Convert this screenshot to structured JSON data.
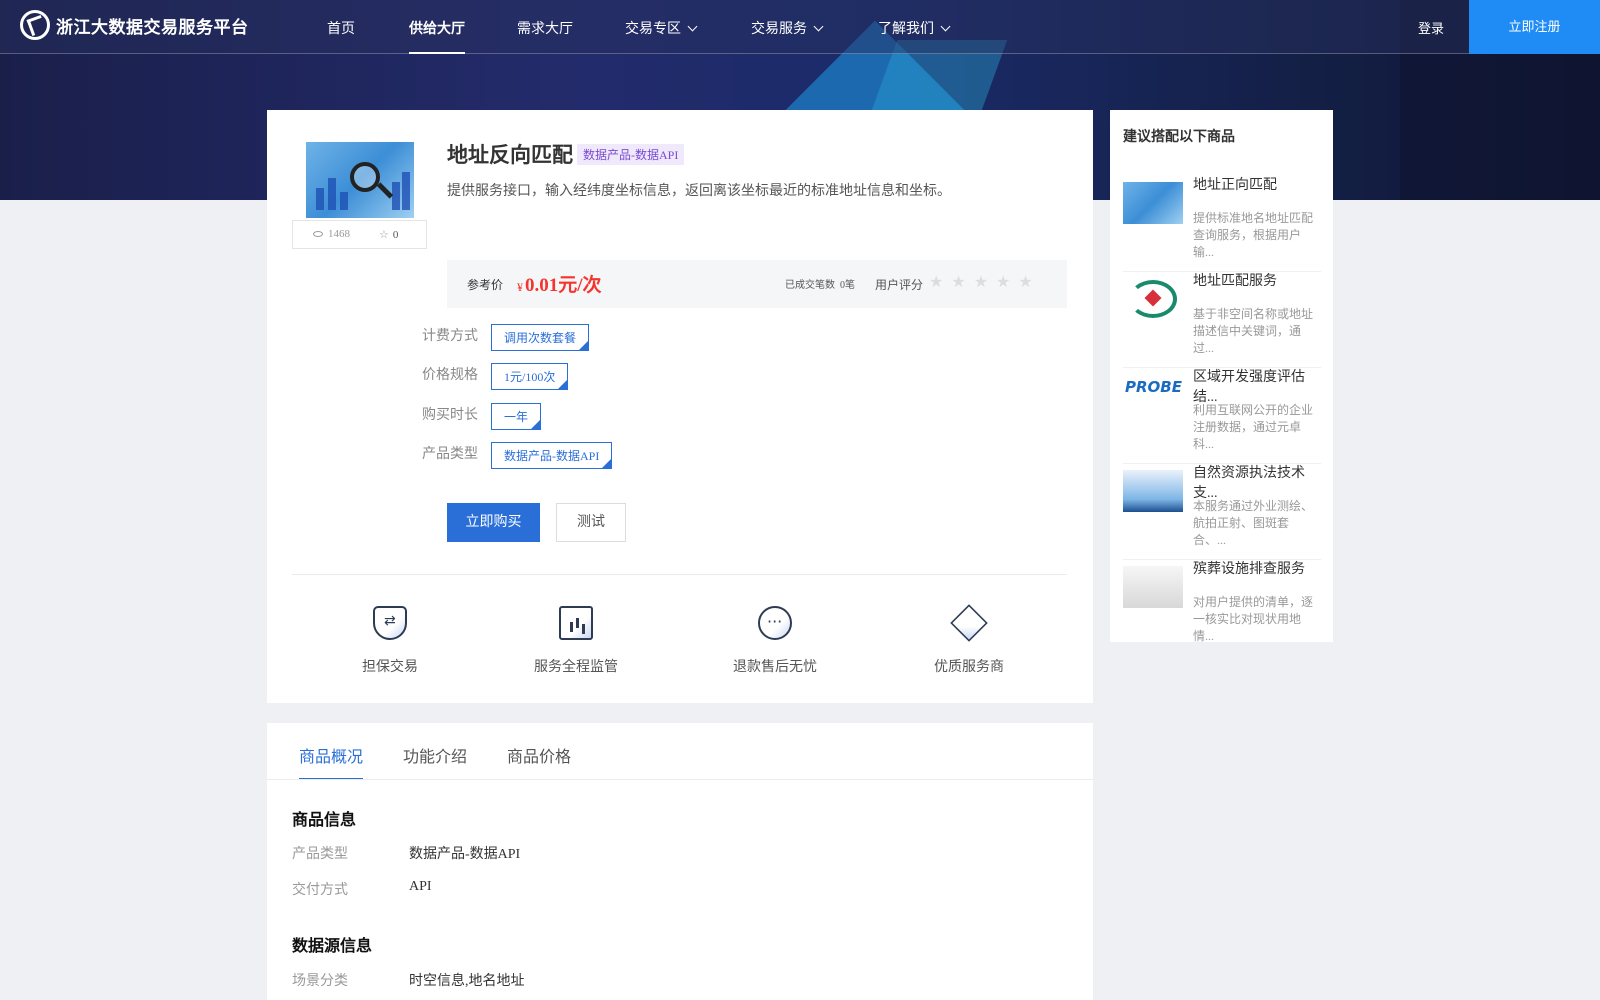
{
  "nav": {
    "logo_text": "浙江大数据交易服务平台",
    "items": [
      "首页",
      "供给大厅",
      "需求大厅",
      "交易专区",
      "交易服务",
      "了解我们"
    ],
    "login": "登录",
    "register": "立即注册"
  },
  "product": {
    "title": "地址反向匹配",
    "tag": "数据产品-数据API",
    "description": "提供服务接口，输入经纬度坐标信息，返回离该坐标最近的标准地址信息和坐标。",
    "views": "1468",
    "favorites": "0",
    "ref_price_label": "参考价",
    "currency": "¥",
    "price": "0.01元/次",
    "deals_label": "已成交笔数",
    "deals_value": "0笔",
    "rating_label": "用户评分",
    "rating": 0,
    "rating_max": 5
  },
  "options": [
    {
      "label": "计费方式",
      "value": "调用次数套餐"
    },
    {
      "label": "价格规格",
      "value": "1元/100次"
    },
    {
      "label": "购买时长",
      "value": "一年"
    },
    {
      "label": "产品类型",
      "value": "数据产品-数据API"
    }
  ],
  "buttons": {
    "buy": "立即购买",
    "test": "测试"
  },
  "features": [
    "担保交易",
    "服务全程监管",
    "退款售后无忧",
    "优质服务商"
  ],
  "sidebar": {
    "title": "建议搭配以下商品",
    "items": [
      {
        "title": "地址正向匹配",
        "desc": "提供标准地名地址匹配查询服务，根据用户输..."
      },
      {
        "title": "地址匹配服务",
        "desc": "基于非空间名称或地址描述信中关键词，通过..."
      },
      {
        "title": "区域开发强度评估结...",
        "desc": "利用互联网公开的企业注册数据，通过元卓科..."
      },
      {
        "title": "自然资源执法技术支...",
        "desc": "本服务通过外业测绘、航拍正射、图斑套合、..."
      },
      {
        "title": "殡葬设施排查服务",
        "desc": "对用户提供的清单，逐一核实比对现状用地情..."
      }
    ]
  },
  "tabs": [
    "商品概况",
    "功能介绍",
    "商品价格"
  ],
  "info": {
    "section1_title": "商品信息",
    "rows1": [
      {
        "label": "产品类型",
        "value": "数据产品-数据API"
      },
      {
        "label": "交付方式",
        "value": "API"
      }
    ],
    "section2_title": "数据源信息",
    "rows2": [
      {
        "label": "场景分类",
        "value": "时空信息,地名地址"
      }
    ]
  },
  "colors": {
    "primary": "#2a6fd8",
    "price": "#f5342d",
    "register_bg": "#1f8cf5"
  }
}
